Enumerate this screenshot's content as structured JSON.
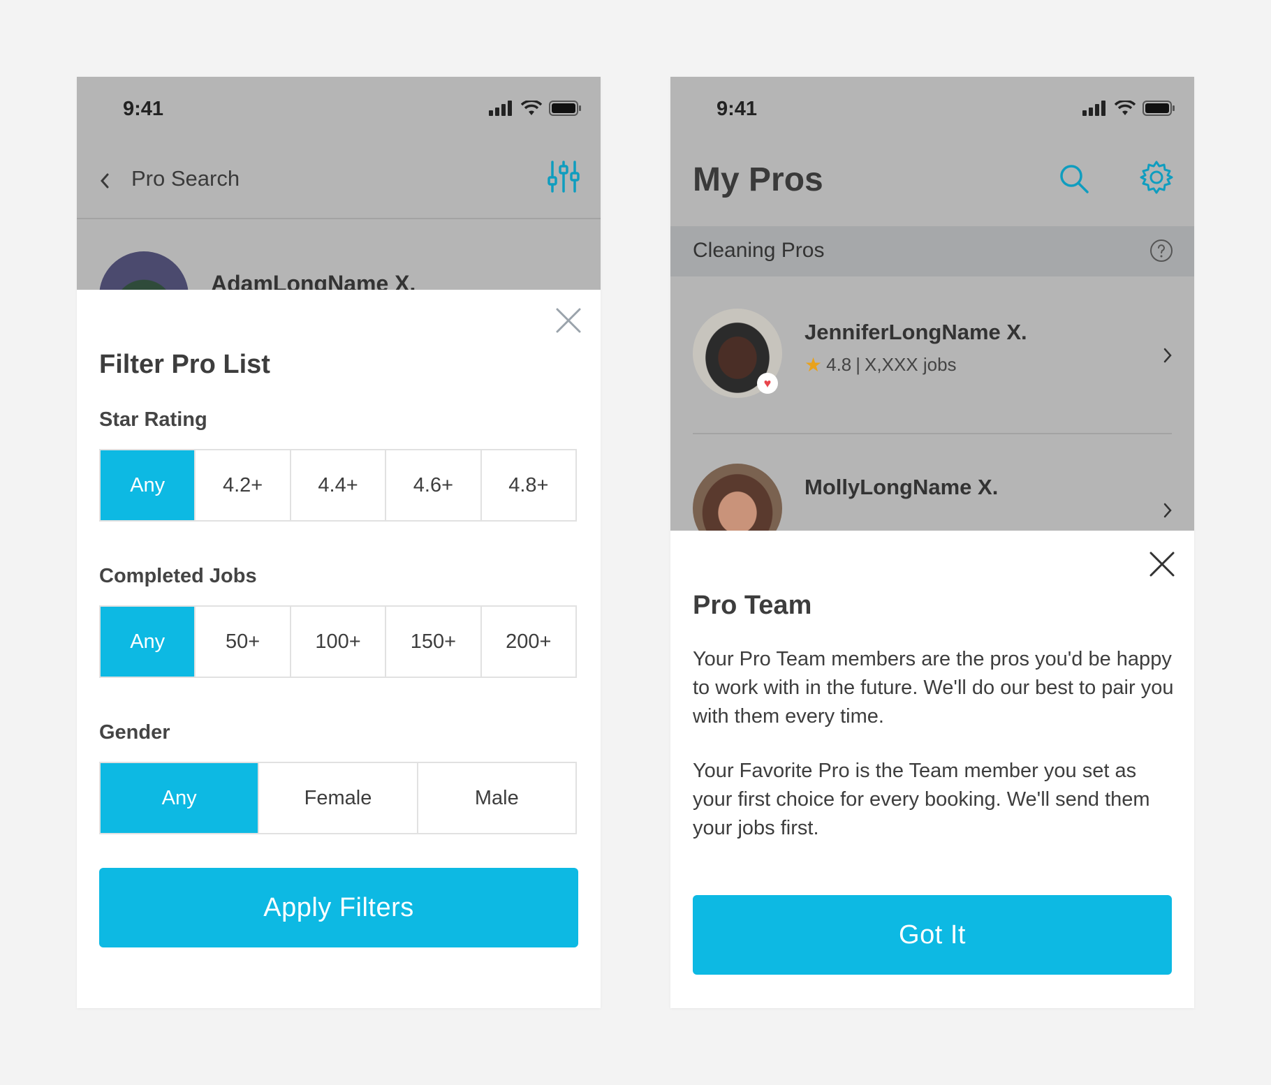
{
  "colors": {
    "accent": "#0db9e3",
    "dim_background": "#b5b5b5",
    "star": "#e9a21b",
    "favorite_heart": "#e8454c"
  },
  "left_screen": {
    "status_time": "9:41",
    "nav": {
      "back_icon": "chevron-left-icon",
      "title": "Pro Search",
      "filter_icon": "sliders-icon"
    },
    "pro_name": "AdamLongName X.",
    "filter_sheet": {
      "close_icon": "close-icon",
      "title": "Filter Pro List",
      "star_rating": {
        "label": "Star Rating",
        "options": [
          "Any",
          "4.2+",
          "4.4+",
          "4.6+",
          "4.8+"
        ],
        "selected": "Any"
      },
      "completed_jobs": {
        "label": "Completed Jobs",
        "options": [
          "Any",
          "50+",
          "100+",
          "150+",
          "200+"
        ],
        "selected": "Any"
      },
      "gender": {
        "label": "Gender",
        "options": [
          "Any",
          "Female",
          "Male"
        ],
        "selected": "Any"
      },
      "apply_label": "Apply Filters"
    }
  },
  "right_screen": {
    "status_time": "9:41",
    "header": {
      "title": "My Pros",
      "search_icon": "search-icon",
      "settings_icon": "gear-icon"
    },
    "section": {
      "label": "Cleaning Pros",
      "help_icon": "question-circle-icon"
    },
    "pros": [
      {
        "name": "JenniferLongName X.",
        "rating": "4.8",
        "jobs": "X,XXX jobs",
        "favorite": true
      },
      {
        "name": "MollyLongName X.",
        "favorite": false
      }
    ],
    "info_sheet": {
      "close_icon": "close-icon",
      "title": "Pro Team",
      "paragraph_1": "Your Pro Team members are the pros you'd be happy to work with in the future. We'll do our best to pair you with them every time.",
      "paragraph_2": "Your Favorite Pro is the Team member you set as your first choice for every booking. We'll send them your jobs first.",
      "button_label": "Got It"
    }
  }
}
